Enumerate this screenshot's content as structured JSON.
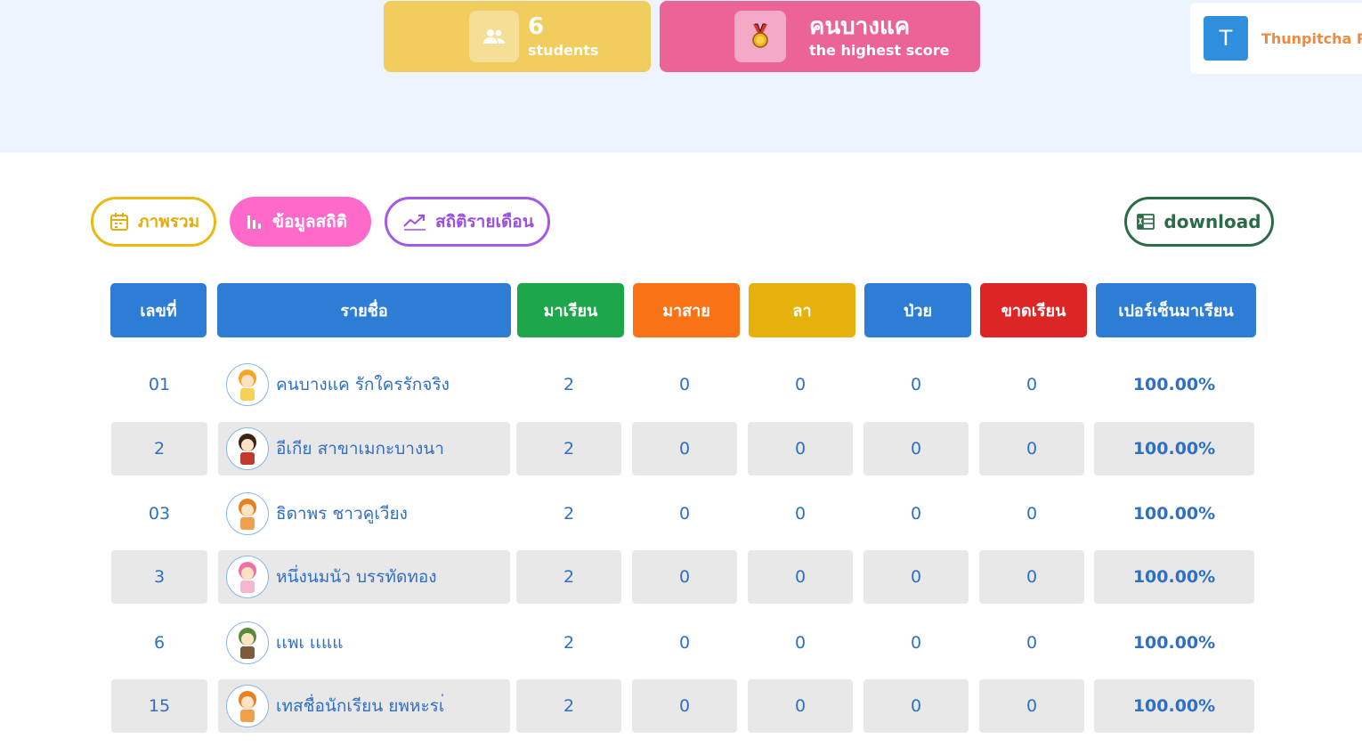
{
  "stats": {
    "students_count": "6",
    "students_label": "students",
    "top_name": "คนบางแค",
    "top_label": "the highest score"
  },
  "user": {
    "initial": "T",
    "name": "Thunpitcha Ra"
  },
  "tabs": [
    {
      "label": "ภาพรวม",
      "icon": "calendar-icon"
    },
    {
      "label": "ข้อมูลสถิติ",
      "icon": "bar-chart-icon"
    },
    {
      "label": "สถิติรายเดือน",
      "icon": "trend-line-icon"
    }
  ],
  "download": {
    "label": "download",
    "icon": "excel-icon"
  },
  "colors": {
    "header_blue": "#2e7dd4",
    "present": "#1da64a",
    "late": "#f97316",
    "leave": "#e6b10c",
    "absent": "#dc2626"
  },
  "table": {
    "headers": [
      "เลขที่",
      "รายชื่อ",
      "มาเรียน",
      "มาสาย",
      "ลา",
      "ป่วย",
      "ขาดเรียน",
      "เปอร์เซ็นมาเรียน"
    ],
    "rows": [
      {
        "no": "01",
        "name": "คนบางแค รักใครรักจริง",
        "present": "2",
        "late": "0",
        "leave": "0",
        "sick": "0",
        "absent": "0",
        "percent": "100.00%"
      },
      {
        "no": "2",
        "name": "อีเกีย สาขาเมกะบางนา",
        "present": "2",
        "late": "0",
        "leave": "0",
        "sick": "0",
        "absent": "0",
        "percent": "100.00%"
      },
      {
        "no": "03",
        "name": "ธิดาพร ชาวคูเวียง",
        "present": "2",
        "late": "0",
        "leave": "0",
        "sick": "0",
        "absent": "0",
        "percent": "100.00%"
      },
      {
        "no": "3",
        "name": "หนึ่งนมนัว บรรทัดทอง",
        "present": "2",
        "late": "0",
        "leave": "0",
        "sick": "0",
        "absent": "0",
        "percent": "100.00%"
      },
      {
        "no": "6",
        "name": "เเพเ เเแแ",
        "present": "2",
        "late": "0",
        "leave": "0",
        "sick": "0",
        "absent": "0",
        "percent": "100.00%"
      },
      {
        "no": "15",
        "name": "เทสชื่อนักเรียน ยพหะรเ่",
        "present": "2",
        "late": "0",
        "leave": "0",
        "sick": "0",
        "absent": "0",
        "percent": "100.00%"
      }
    ]
  }
}
